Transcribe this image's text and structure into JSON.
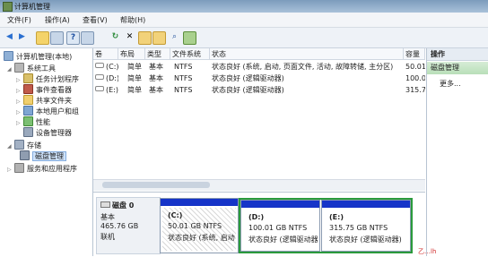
{
  "window": {
    "title": "计算机管理"
  },
  "menu": [
    "文件(F)",
    "操作(A)",
    "查看(V)",
    "帮助(H)"
  ],
  "toolbar": [
    "back-icon",
    "forward-icon",
    "up-icon",
    "console-icon",
    "help-icon",
    "properties-icon",
    "refresh-icon",
    "delete-icon",
    "open-icon",
    "folder-icon",
    "search-icon",
    "export-icon"
  ],
  "tree": {
    "root": "计算机管理(本地)",
    "items": [
      {
        "label": "系统工具"
      },
      {
        "label": "任务计划程序"
      },
      {
        "label": "事件查看器"
      },
      {
        "label": "共享文件夹"
      },
      {
        "label": "本地用户和组"
      },
      {
        "label": "性能"
      },
      {
        "label": "设备管理器"
      },
      {
        "label": "存储"
      },
      {
        "label": "磁盘管理"
      },
      {
        "label": "服务和应用程序"
      }
    ]
  },
  "volume_table": {
    "headers": [
      "卷",
      "布局",
      "类型",
      "文件系统",
      "状态",
      "容量"
    ],
    "rows": [
      [
        "(C:)",
        "简单",
        "基本",
        "NTFS",
        "状态良好 (系统, 启动, 页面文件, 活动, 故障转储, 主分区)",
        "50.01"
      ],
      [
        "(D:)",
        "简单",
        "基本",
        "NTFS",
        "状态良好 (逻辑驱动器)",
        "100.0"
      ],
      [
        "(E:)",
        "简单",
        "基本",
        "NTFS",
        "状态良好 (逻辑驱动器)",
        "315.7"
      ]
    ]
  },
  "disk": {
    "name": "磁盘 0",
    "type": "基本",
    "size": "465.76 GB",
    "status": "联机",
    "partitions": [
      {
        "letter": "(C:)",
        "size": "50.01 GB NTFS",
        "status": "状态良好 (系统, 启动"
      },
      {
        "letter": "(D:)",
        "size": "100.01 GB NTFS",
        "status": "状态良好 (逻辑驱动器)"
      },
      {
        "letter": "(E:)",
        "size": "315.75 GB NTFS",
        "status": "状态良好 (逻辑驱动器)"
      }
    ]
  },
  "actions": {
    "title": "操作",
    "subtitle": "磁盘管理",
    "more": "更多..."
  },
  "watermark": "乙…lh"
}
